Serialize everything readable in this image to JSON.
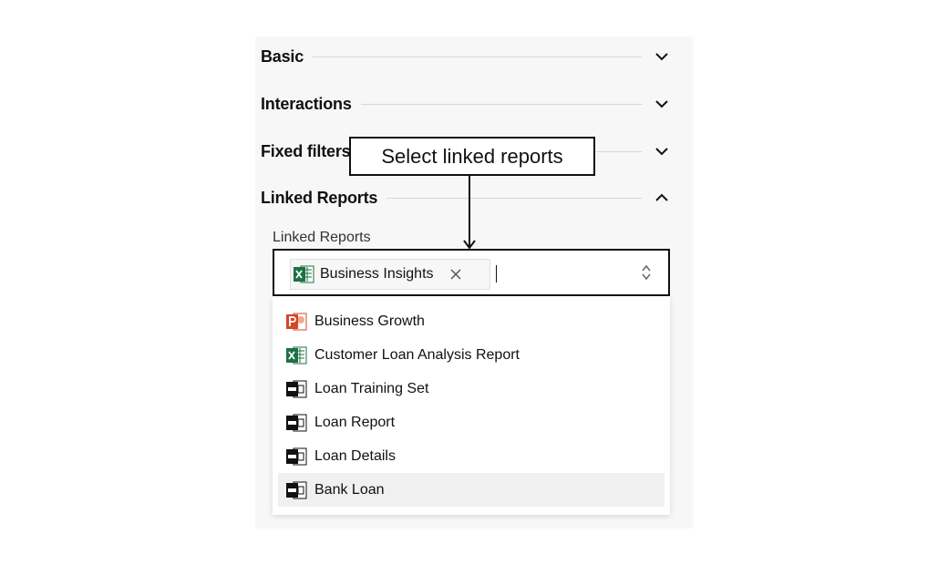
{
  "sections": [
    {
      "title": "Basic",
      "expanded": false
    },
    {
      "title": "Interactions",
      "expanded": false
    },
    {
      "title": "Fixed filters",
      "expanded": false
    },
    {
      "title": "Linked Reports",
      "expanded": true
    }
  ],
  "linked_reports": {
    "label": "Linked Reports",
    "selected": [
      {
        "label": "Business Insights",
        "icon": "excel-icon"
      }
    ],
    "options": [
      {
        "label": "Business Growth",
        "icon": "powerpoint-icon"
      },
      {
        "label": "Customer Loan Analysis Report",
        "icon": "excel-icon"
      },
      {
        "label": "Loan Training Set",
        "icon": "csv-icon"
      },
      {
        "label": "Loan Report",
        "icon": "csv-icon"
      },
      {
        "label": "Loan Details",
        "icon": "csv-icon"
      },
      {
        "label": "Bank Loan",
        "icon": "csv-icon",
        "highlighted": true
      }
    ]
  },
  "callout": {
    "text": "Select linked reports"
  },
  "colors": {
    "excel": "#1e7145",
    "powerpoint": "#d24726",
    "csv": "#111111",
    "highlight": "#f0f0f0"
  }
}
